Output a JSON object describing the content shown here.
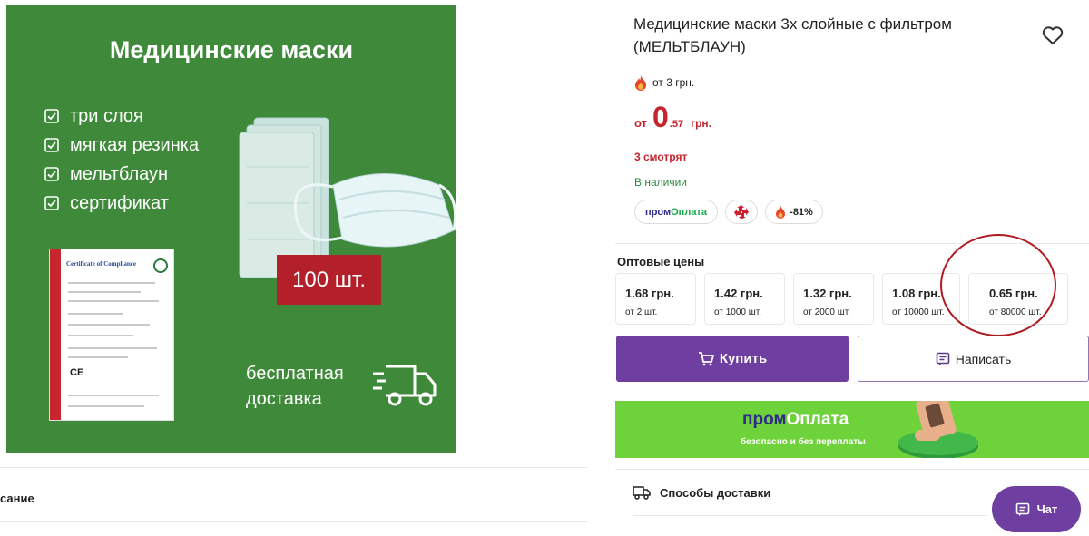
{
  "image": {
    "title": "Медицинские маски",
    "features": [
      "три слоя",
      "мягкая резинка",
      "мельтблаун",
      "сертификат"
    ],
    "quantity_badge": "100 шт.",
    "certificate_title": "Certificate of Compliance",
    "certificate_mark": "CE",
    "delivery_line1": "бесплатная",
    "delivery_line2": "доставка"
  },
  "product": {
    "title": "Медицинские маски 3х слойные с фильтром (МЕЛЬТБЛАУН)",
    "old_price": "от 3 грн.",
    "price_from": "от",
    "price_int": "0",
    "price_frac": ".57",
    "price_currency": "грн.",
    "views": "3 смотрят",
    "stock": "В наличии"
  },
  "badges": {
    "prom_part1": "пром",
    "prom_part2": "Оплата",
    "discount": "-81%"
  },
  "wholesale": {
    "title": "Оптовые цены",
    "tiers": [
      {
        "price": "1.68 грн.",
        "qty": "от 2 шт."
      },
      {
        "price": "1.42 грн.",
        "qty": "от 1000 шт."
      },
      {
        "price": "1.32 грн.",
        "qty": "от 2000 шт."
      },
      {
        "price": "1.08 грн.",
        "qty": "от 10000 шт."
      },
      {
        "price": "0.65 грн.",
        "qty": "от 80000 шт."
      }
    ]
  },
  "actions": {
    "buy": "Купить",
    "write": "Написать"
  },
  "promo": {
    "brand_part1": "пром",
    "brand_part2": "Оплата",
    "tagline": "безопасно и без переплаты"
  },
  "bottom": {
    "description_tab": "сание",
    "delivery_methods": "Способы доставки",
    "chat": "Чат"
  },
  "colors": {
    "accent_purple": "#6e3ea0",
    "price_red": "#c4262e",
    "stock_green": "#2e8b45",
    "image_green": "#3f8a3a",
    "promo_green": "#6ed23b"
  }
}
